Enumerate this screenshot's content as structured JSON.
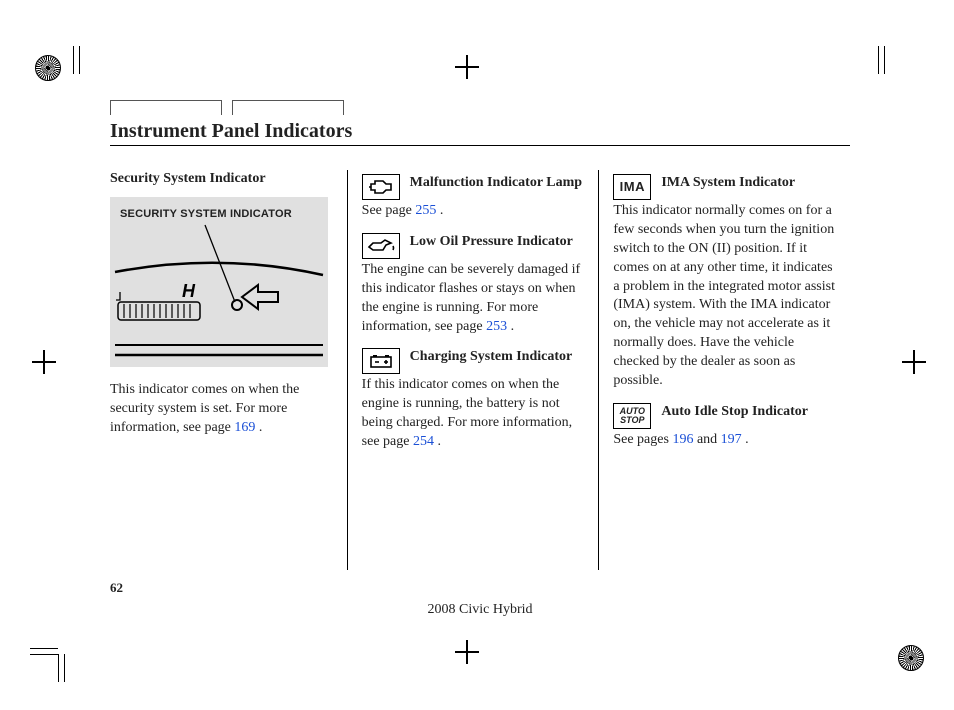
{
  "page": {
    "title": "Instrument Panel Indicators",
    "number": "62",
    "model_year": "2008  Civic  Hybrid"
  },
  "col1": {
    "heading": "Security System Indicator",
    "figure_label": "SECURITY SYSTEM INDICATOR",
    "body_pre": "This indicator comes on when the security system is set. For more information, see page ",
    "page_link": "169",
    "body_post": " ."
  },
  "col2": {
    "mil": {
      "title": "Malfunction Indicator Lamp",
      "body_pre": "See page ",
      "page_link": "255",
      "body_post": " ."
    },
    "oil": {
      "title": "Low Oil Pressure Indicator",
      "body_pre": "The engine can be severely damaged if this indicator flashes or stays on when the engine is running. For more information, see page ",
      "page_link": "253",
      "body_post": " ."
    },
    "charge": {
      "title": "Charging System Indicator",
      "body_pre": "If this indicator comes on when the engine is running, the battery is not being charged. For more information, see page ",
      "page_link": "254",
      "body_post": " ."
    }
  },
  "col3": {
    "ima": {
      "icon_text": "IMA",
      "title": "IMA System Indicator",
      "body": "This indicator normally comes on for a few seconds when you turn the ignition switch to the ON (II) position. If it comes on at any other time, it indicates a problem in the integrated motor assist (IMA) system. With the IMA indicator on, the vehicle may not accelerate as it normally does. Have the vehicle checked by the dealer as soon as possible."
    },
    "autostop": {
      "icon_line1": "AUTO",
      "icon_line2": "STOP",
      "title": "Auto Idle Stop Indicator",
      "body_pre": "See pages ",
      "page_link1": "196",
      "body_mid": " and ",
      "page_link2": "197",
      "body_post": " ."
    }
  }
}
